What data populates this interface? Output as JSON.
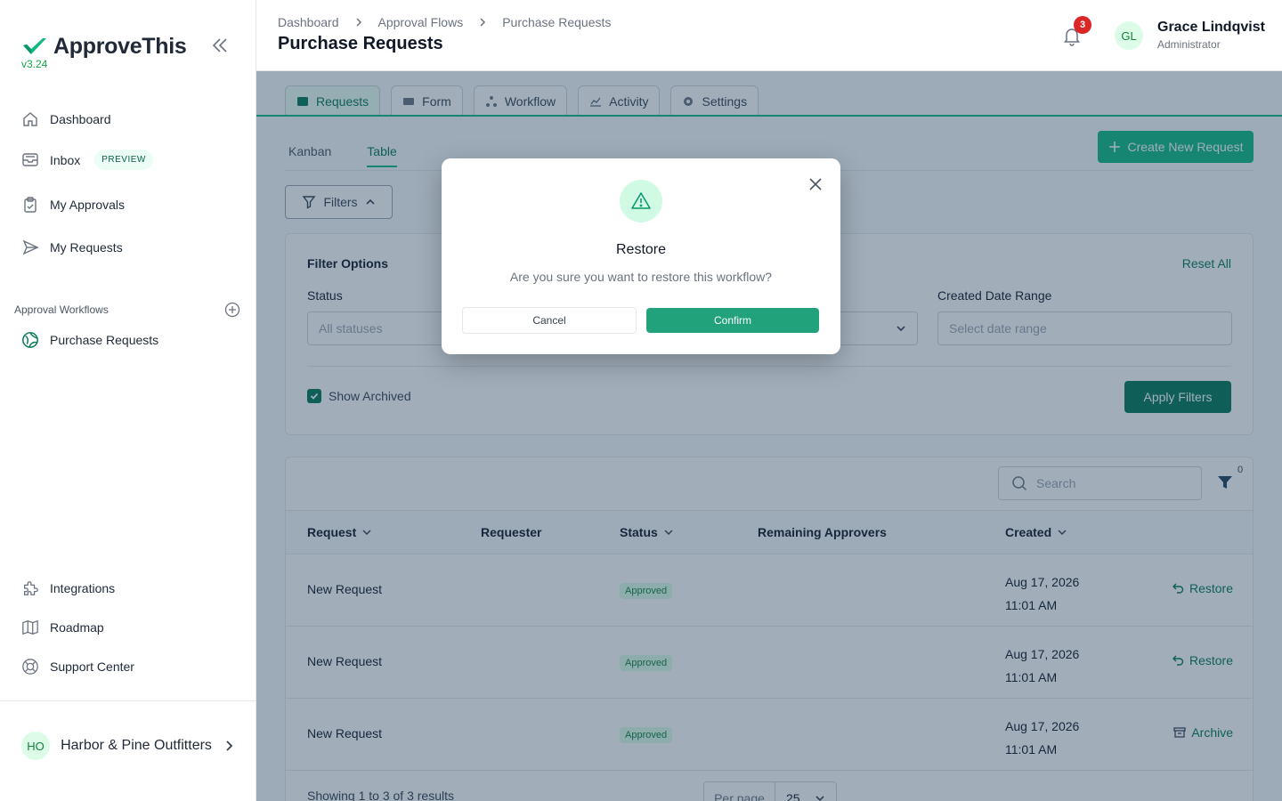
{
  "brand": {
    "name": "ApproveThis",
    "version": "v3.24",
    "accent": "#10b981"
  },
  "sidebar": {
    "items": [
      {
        "label": "Dashboard",
        "icon": "home-icon"
      },
      {
        "label": "Inbox",
        "icon": "inbox-icon",
        "badge": "PREVIEW"
      },
      {
        "label": "My Approvals",
        "icon": "clipboard-check-icon"
      },
      {
        "label": "My Requests",
        "icon": "send-icon"
      }
    ],
    "section_label": "Approval Workflows",
    "workflows": [
      {
        "label": "Purchase Requests",
        "icon": "workflow-globe-icon"
      }
    ],
    "bottom_items": [
      {
        "label": "Integrations",
        "icon": "puzzle-icon"
      },
      {
        "label": "Roadmap",
        "icon": "map-icon"
      },
      {
        "label": "Support Center",
        "icon": "lifebuoy-icon"
      }
    ],
    "org": {
      "initials": "HO",
      "name": "Harbor & Pine Outfitters"
    }
  },
  "header": {
    "breadcrumb": [
      "Dashboard",
      "Approval Flows",
      "Purchase Requests"
    ],
    "title": "Purchase Requests",
    "notifications": "3",
    "user": {
      "initials": "GL",
      "name": "Grace Lindqvist",
      "role": "Administrator"
    }
  },
  "main": {
    "tabs": [
      {
        "label": "Requests",
        "active": true
      },
      {
        "label": "Form"
      },
      {
        "label": "Workflow"
      },
      {
        "label": "Activity"
      },
      {
        "label": "Settings"
      }
    ],
    "views": [
      "Kanban",
      "Table"
    ],
    "active_view": "Table",
    "create_label": "Create New Request",
    "filters_label": "Filters",
    "filter_panel": {
      "title": "Filter Options",
      "reset": "Reset All",
      "status_label": "Status",
      "status_placeholder": "All statuses",
      "date_label": "Created Date Range",
      "date_placeholder": "Select date range",
      "show_archived": "Show Archived",
      "apply": "Apply Filters"
    },
    "table": {
      "search_placeholder": "Search",
      "filter_count": "0",
      "columns": [
        "Request",
        "Requester",
        "Status",
        "Remaining Approvers",
        "Created"
      ],
      "rows": [
        {
          "request": "New Request",
          "status": "Approved",
          "date": "Aug 17, 2026",
          "time": "11:01 AM",
          "action": "Restore"
        },
        {
          "request": "New Request",
          "status": "Approved",
          "date": "Aug 17, 2026",
          "time": "11:01 AM",
          "action": "Restore"
        },
        {
          "request": "New Request",
          "status": "Approved",
          "date": "Aug 17, 2026",
          "time": "11:01 AM",
          "action": "Archive"
        }
      ],
      "footer": "Showing 1 to 3 of 3 results",
      "per_page_label": "Per page",
      "per_page_value": "25"
    }
  },
  "modal": {
    "title": "Restore",
    "message": "Are you sure you want to restore this workflow?",
    "cancel": "Cancel",
    "confirm": "Confirm"
  }
}
